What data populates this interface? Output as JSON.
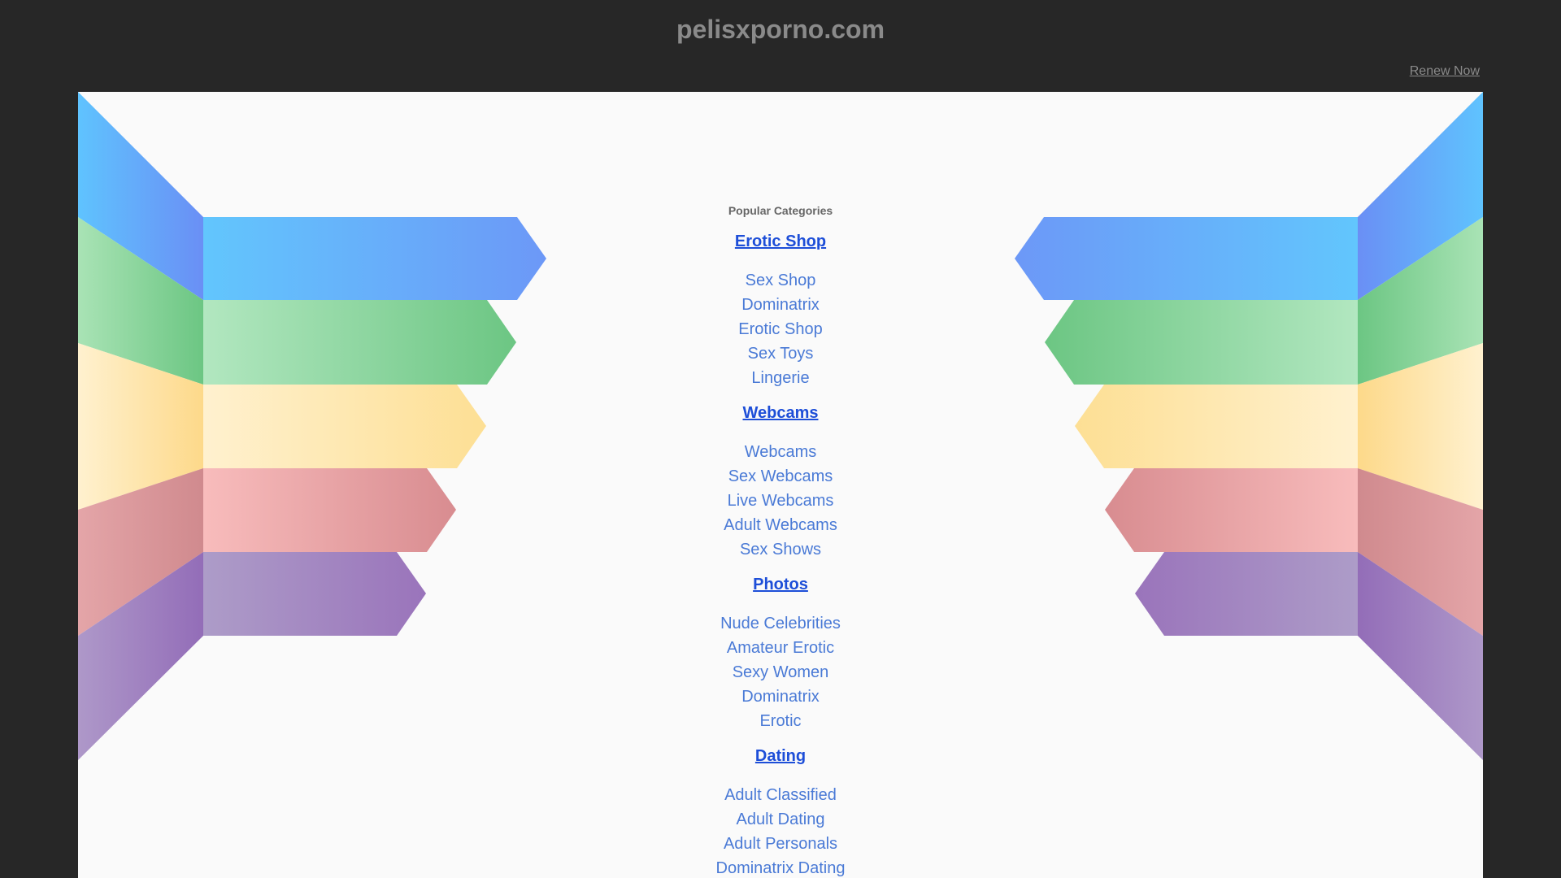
{
  "header": {
    "domain": "pelisxporno.com",
    "renew_label": "Renew Now"
  },
  "categories": {
    "heading": "Popular Categories",
    "groups": [
      {
        "title": "Erotic Shop",
        "links": [
          "Sex Shop",
          "Dominatrix",
          "Erotic Shop",
          "Sex Toys",
          "Lingerie"
        ]
      },
      {
        "title": "Webcams",
        "links": [
          "Webcams",
          "Sex Webcams",
          "Live Webcams",
          "Adult Webcams",
          "Sex Shows"
        ]
      },
      {
        "title": "Photos",
        "links": [
          "Nude Celebrities",
          "Amateur Erotic",
          "Sexy Women",
          "Dominatrix",
          "Erotic"
        ]
      },
      {
        "title": "Dating",
        "links": [
          "Adult Classified",
          "Adult Dating",
          "Adult Personals",
          "Dominatrix Dating"
        ]
      }
    ]
  },
  "colors": {
    "background": "#272727",
    "panel": "#fafafa",
    "title_text": "#8a8a8a",
    "group_title": "#1d4ed8",
    "link": "#4a7ad6",
    "blue": "#5ec4ff",
    "green": "#7fd394",
    "yellow": "#ffe29a",
    "red": "#e89aa0",
    "purple": "#a88cc8"
  }
}
